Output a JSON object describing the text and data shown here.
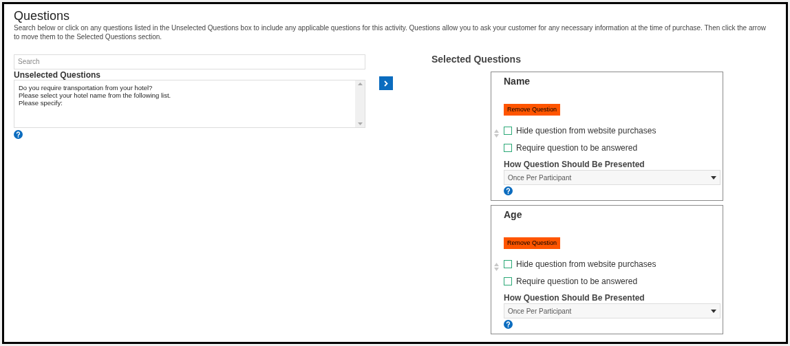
{
  "title": "Questions",
  "description": "Search below or click on any questions listed in the Unselected Questions box to include any applicable questions for this activity. Questions allow you to ask your customer for any necessary information at the time of purchase. Then click the arrow to move them to the Selected Questions section.",
  "search": {
    "placeholder": "Search"
  },
  "unselected": {
    "label": "Unselected Questions",
    "items": [
      {
        "text": "Do you require transportation from your hotel?",
        "selected": false
      },
      {
        "text": "Please select your hotel name from the following list.",
        "selected": false
      },
      {
        "text": "Please specify:",
        "selected": false
      }
    ]
  },
  "selected_heading": "Selected Questions",
  "questions": [
    {
      "title": "Name",
      "remove_label": "Remove Question",
      "options": [
        {
          "label": "Hide question from website purchases",
          "checked": false
        },
        {
          "label": "Require question to be answered",
          "checked": false
        }
      ],
      "presentation_label": "How Question Should Be Presented",
      "presentation_value": "Once Per Participant"
    },
    {
      "title": "Age",
      "remove_label": "Remove Question",
      "options": [
        {
          "label": "Hide question from website purchases",
          "checked": false
        },
        {
          "label": "Require question to be answered",
          "checked": false
        }
      ],
      "presentation_label": "How Question Should Be Presented",
      "presentation_value": "Once Per Participant"
    }
  ]
}
